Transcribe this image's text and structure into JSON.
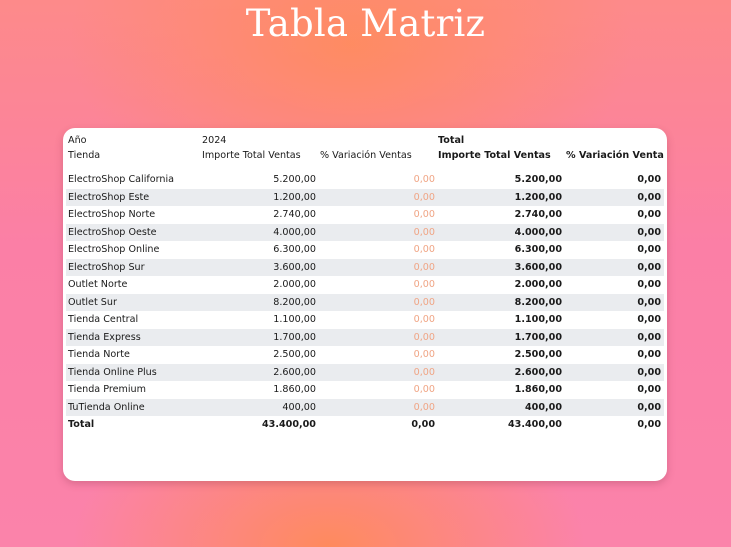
{
  "title": "Tabla Matriz",
  "matrix": {
    "header": {
      "year_label": "Año",
      "year_value": "2024",
      "total_group_label": "Total",
      "row_header": "Tienda",
      "col_importe": "Importe Total Ventas",
      "col_variacion": "% Variación Ventas",
      "col_total_importe": "Importe Total Ventas",
      "col_total_variacion": "% Variación Ventas",
      "sort_icon": "▲"
    },
    "rows": [
      {
        "store": "ElectroShop California",
        "importe": "5.200,00",
        "variacion": "0,00",
        "total_importe": "5.200,00",
        "total_variacion": "0,00"
      },
      {
        "store": "ElectroShop Este",
        "importe": "1.200,00",
        "variacion": "0,00",
        "total_importe": "1.200,00",
        "total_variacion": "0,00"
      },
      {
        "store": "ElectroShop Norte",
        "importe": "2.740,00",
        "variacion": "0,00",
        "total_importe": "2.740,00",
        "total_variacion": "0,00"
      },
      {
        "store": "ElectroShop Oeste",
        "importe": "4.000,00",
        "variacion": "0,00",
        "total_importe": "4.000,00",
        "total_variacion": "0,00"
      },
      {
        "store": "ElectroShop Online",
        "importe": "6.300,00",
        "variacion": "0,00",
        "total_importe": "6.300,00",
        "total_variacion": "0,00"
      },
      {
        "store": "ElectroShop Sur",
        "importe": "3.600,00",
        "variacion": "0,00",
        "total_importe": "3.600,00",
        "total_variacion": "0,00"
      },
      {
        "store": "Outlet Norte",
        "importe": "2.000,00",
        "variacion": "0,00",
        "total_importe": "2.000,00",
        "total_variacion": "0,00"
      },
      {
        "store": "Outlet Sur",
        "importe": "8.200,00",
        "variacion": "0,00",
        "total_importe": "8.200,00",
        "total_variacion": "0,00"
      },
      {
        "store": "Tienda Central",
        "importe": "1.100,00",
        "variacion": "0,00",
        "total_importe": "1.100,00",
        "total_variacion": "0,00"
      },
      {
        "store": "Tienda Express",
        "importe": "1.700,00",
        "variacion": "0,00",
        "total_importe": "1.700,00",
        "total_variacion": "0,00"
      },
      {
        "store": "Tienda Norte",
        "importe": "2.500,00",
        "variacion": "0,00",
        "total_importe": "2.500,00",
        "total_variacion": "0,00"
      },
      {
        "store": "Tienda Online Plus",
        "importe": "2.600,00",
        "variacion": "0,00",
        "total_importe": "2.600,00",
        "total_variacion": "0,00"
      },
      {
        "store": "Tienda Premium",
        "importe": "1.860,00",
        "variacion": "0,00",
        "total_importe": "1.860,00",
        "total_variacion": "0,00"
      },
      {
        "store": "TuTienda Online",
        "importe": "400,00",
        "variacion": "0,00",
        "total_importe": "400,00",
        "total_variacion": "0,00"
      }
    ],
    "total_row": {
      "label": "Total",
      "importe": "43.400,00",
      "variacion": "0,00",
      "total_importe": "43.400,00",
      "total_variacion": "0,00"
    }
  },
  "colors": {
    "zebra": "#eaecef",
    "muted_value": "#f0a585",
    "background_top": "#fd8a8a",
    "background_bottom": "#fb83aa",
    "glow": "#ff8c5a"
  }
}
